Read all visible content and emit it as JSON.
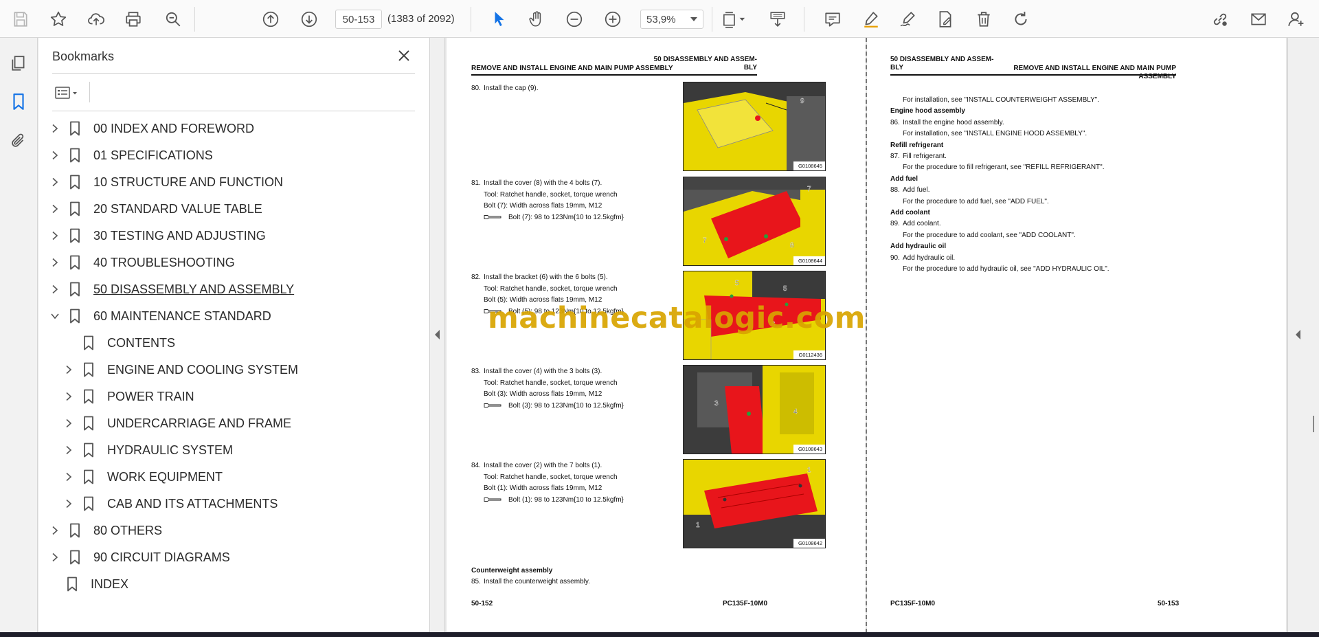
{
  "toolbar": {
    "page_input": "50-153",
    "page_count": "(1383 of 2092)",
    "zoom": "53,9%"
  },
  "bookmarks_panel": {
    "title": "Bookmarks",
    "items": [
      {
        "label": "00 INDEX AND FOREWORD"
      },
      {
        "label": "01 SPECIFICATIONS"
      },
      {
        "label": "10 STRUCTURE AND FUNCTION"
      },
      {
        "label": "20 STANDARD VALUE TABLE"
      },
      {
        "label": "30 TESTING AND ADJUSTING"
      },
      {
        "label": "40 TROUBLESHOOTING"
      },
      {
        "label": " 50 DISASSEMBLY AND ASSEMBLY"
      },
      {
        "label": "60 MAINTENANCE STANDARD"
      },
      {
        "label": "CONTENTS"
      },
      {
        "label": "ENGINE AND COOLING SYSTEM"
      },
      {
        "label": "POWER TRAIN"
      },
      {
        "label": "UNDERCARRIAGE AND FRAME"
      },
      {
        "label": "HYDRAULIC SYSTEM"
      },
      {
        "label": "WORK EQUIPMENT"
      },
      {
        "label": "CAB AND ITS ATTACHMENTS"
      },
      {
        "label": "80 OTHERS"
      },
      {
        "label": "90 CIRCUIT DIAGRAMS"
      },
      {
        "label": "INDEX"
      }
    ]
  },
  "left_page": {
    "header_left": "REMOVE AND INSTALL ENGINE AND MAIN PUMP ASSEMBLY",
    "header_right_1": "50 DISASSEMBLY AND ASSEM-",
    "header_right_2": "BLY",
    "steps": [
      {
        "num": "80.",
        "lines": [
          "Install the cap (9)."
        ],
        "torque": "",
        "figure": "G0108645",
        "callouts": [
          "9"
        ]
      },
      {
        "num": "81.",
        "lines": [
          "Install the cover (8) with the 4 bolts (7).",
          "Tool: Ratchet handle, socket, torque wrench",
          "Bolt (7): Width across flats 19mm, M12"
        ],
        "torque": "Bolt (7): 98 to 123Nm{10 to 12.5kgfm}",
        "figure": "G0108644",
        "callouts": [
          "7",
          "7",
          "8"
        ]
      },
      {
        "num": "82.",
        "lines": [
          "Install the bracket (6) with the 6 bolts (5).",
          "Tool: Ratchet handle, socket, torque wrench",
          "Bolt (5): Width across flats 19mm, M12"
        ],
        "torque": "Bolt (5): 98 to 123Nm{10 to 12.5kgfm}",
        "figure": "G0112436",
        "callouts": [
          "5",
          "5",
          "6"
        ]
      },
      {
        "num": "83.",
        "lines": [
          "Install the cover (4) with the 3 bolts (3).",
          "Tool: Ratchet handle, socket, torque wrench",
          "Bolt (3): Width across flats 19mm, M12"
        ],
        "torque": "Bolt (3): 98 to 123Nm{10 to 12.5kgfm}",
        "figure": "G0108643",
        "callouts": [
          "3",
          "4"
        ]
      },
      {
        "num": "84.",
        "lines": [
          "Install the cover (2) with the 7 bolts (1).",
          "Tool: Ratchet handle, socket, torque wrench",
          "Bolt (1): Width across flats 19mm, M12"
        ],
        "torque": "Bolt (1): 98 to 123Nm{10 to 12.5kgfm}",
        "figure": "G0108642",
        "callouts": [
          "1",
          "1"
        ]
      }
    ],
    "section_heading": "Counterweight assembly",
    "last_step_num": "85.",
    "last_step_text": "Install the counterweight assembly.",
    "footer_left": "50-152",
    "footer_right": "PC135F-10M0"
  },
  "right_page": {
    "header_left_1": "50 DISASSEMBLY AND ASSEM-",
    "header_left_2": "BLY",
    "header_right": "REMOVE AND INSTALL ENGINE AND MAIN PUMP ASSEMBLY",
    "blocks": [
      {
        "type": "text",
        "text": "For installation, see \"INSTALL COUNTERWEIGHT ASSEMBLY\"."
      },
      {
        "type": "heading",
        "text": "Engine hood assembly"
      },
      {
        "type": "step",
        "num": "86.",
        "text": "Install the engine hood assembly."
      },
      {
        "type": "text",
        "text": "For installation, see \"INSTALL ENGINE HOOD ASSEMBLY\"."
      },
      {
        "type": "heading",
        "text": "Refill refrigerant"
      },
      {
        "type": "step",
        "num": "87.",
        "text": "Fill refrigerant."
      },
      {
        "type": "text",
        "text": "For the procedure to fill refrigerant, see \"REFILL REFRIGERANT\"."
      },
      {
        "type": "heading",
        "text": "Add fuel"
      },
      {
        "type": "step",
        "num": "88.",
        "text": "Add fuel."
      },
      {
        "type": "text",
        "text": "For the procedure to add fuel, see \"ADD FUEL\"."
      },
      {
        "type": "heading",
        "text": "Add coolant"
      },
      {
        "type": "step",
        "num": "89.",
        "text": "Add coolant."
      },
      {
        "type": "text",
        "text": "For the procedure to add coolant, see \"ADD COOLANT\"."
      },
      {
        "type": "heading",
        "text": "Add hydraulic oil"
      },
      {
        "type": "step",
        "num": "90.",
        "text": "Add hydraulic oil."
      },
      {
        "type": "text",
        "text": "For the procedure to add hydraulic oil, see \"ADD HYDRAULIC OIL\"."
      }
    ],
    "footer_left": "PC135F-10M0",
    "footer_right": "50-153"
  },
  "watermark": "machinecatalogic.com",
  "colors": {
    "accent_blue": "#1473e6",
    "figure_yellow": "#e8d600",
    "figure_red": "#e8151b",
    "watermark": "#d9a400"
  }
}
